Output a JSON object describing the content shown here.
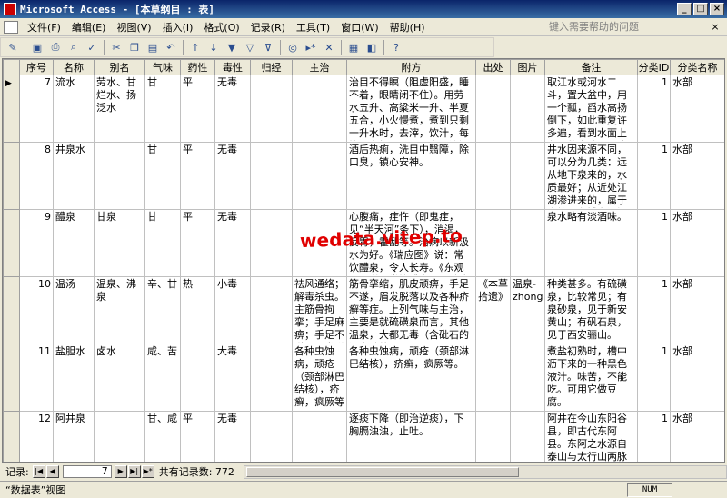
{
  "window": {
    "title": "Microsoft Access - [本草纲目 : 表]",
    "min": "_",
    "max": "□",
    "close": "×"
  },
  "menu": {
    "items": [
      "文件(F)",
      "编辑(E)",
      "视图(V)",
      "插入(I)",
      "格式(O)",
      "记录(R)",
      "工具(T)",
      "窗口(W)",
      "帮助(H)"
    ],
    "help_placeholder": "键入需要帮助的问题",
    "close": "×"
  },
  "toolbar": {
    "icons": [
      "view-icon",
      "save-icon",
      "print-icon",
      "preview-icon",
      "spell-icon",
      "cut-icon",
      "copy-icon",
      "paste-icon",
      "undo-icon",
      "sort-asc-icon",
      "sort-desc-icon",
      "filter-icon",
      "filter-form-icon",
      "apply-filter-icon",
      "find-icon",
      "new-record-icon",
      "delete-record-icon",
      "database-window-icon",
      "new-object-icon",
      "help-icon"
    ]
  },
  "columns": [
    "序号",
    "名称",
    "别名",
    "气味",
    "药性",
    "毒性",
    "归经",
    "主治",
    "附方",
    "出处",
    "图片",
    "备注",
    "分类ID",
    "分类名称"
  ],
  "rows": [
    {
      "id": "7",
      "name": "流水",
      "alias": "劳水、甘烂水、扬泛水",
      "taste": "甘",
      "nature": "平",
      "toxicity": "无毒",
      "meridian": "",
      "indication": "",
      "formula": "治目不得瞑（阻虚阳盛，睡不着，眼睛闭不住）。用劳水五升、高粱米一升、半夏五合，小火慢煮，煮到只剩一升水时，去滓，饮汁，每饮一小杯。一日三次。治汗后奔豚",
      "source": "",
      "image": "",
      "note": "取江水或河水二斗，置大盆中，用一个瓢，舀水高扬倒下，如此重复许多遍，看到水面上有无数水珠滚来滚去便是",
      "cat_id": "1",
      "cat_name": "水部"
    },
    {
      "id": "8",
      "name": "井泉水",
      "alias": "",
      "taste": "甘",
      "nature": "平",
      "toxicity": "无毒",
      "meridian": "",
      "indication": "",
      "formula": "酒后热痢，洗目中翳障，除口臭，镇心安神。",
      "source": "",
      "image": "",
      "note": "井水因来源不同，可以分为几类：远从地下泉来的，水质最好；从近处江湖渗进来的，属于次等；有城市沟渠污水",
      "cat_id": "1",
      "cat_name": "水部"
    },
    {
      "id": "9",
      "name": "醴泉",
      "alias": "甘泉",
      "taste": "甘",
      "nature": "平",
      "toxicity": "无毒",
      "meridian": "",
      "indication": "",
      "formula": "心腹痛，疰忤（即鬼疰，见“半天河”条下），消渴，反胃，霍乱等。治病以新汲水为好。《瑞应图》说：常饮醴泉，令人长寿。《东观记》说：常饮醴泉，可除痼疾（久",
      "source": "",
      "image": "",
      "note": "泉水略有淡酒味。",
      "cat_id": "1",
      "cat_name": "水部"
    },
    {
      "id": "10",
      "name": "温汤",
      "alias": "温泉、沸泉",
      "taste": "辛、甘",
      "nature": "热",
      "toxicity": "小毒",
      "meridian": "",
      "indication": "祛风通络；解毒杀虫。主筋骨拘挛；手足麻痹；手足不遂；眉发脱落；",
      "formula": "筋骨挛缩，肌皮顽痹，手足不遂，眉发脱落以及各种疥癣等症。上列气味与主治，主要是就硫磺泉而言，其他温泉，大都无毒（含砒石的温泉除外），即",
      "source": "《本草拾遗》",
      "image": "温泉-zhongyao.jpg",
      "note": "种类甚多。有硫磺泉，比较常见；有泉砂泉，见于新安黄山；有矾石泉，见于西安骊山。",
      "cat_id": "1",
      "cat_name": "水部"
    },
    {
      "id": "11",
      "name": "盐胆水",
      "alias": "卤水",
      "taste": "咸、苦",
      "nature": "",
      "toxicity": "大毒",
      "meridian": "",
      "indication": "各种虫蚀病，顽疮（颈部淋巴结核），疥癣，疯厥等",
      "formula": "各种虫蚀病，顽疮（颈部淋巴结核），疥癣，疯厥等。",
      "source": "",
      "image": "",
      "note": "煮盐初熟时，槽中沥下来的一种黑色液汁。味苦，不能吃。可用它做豆腐。",
      "cat_id": "1",
      "cat_name": "水部"
    },
    {
      "id": "12",
      "name": "阿井泉",
      "alias": "",
      "taste": "甘、咸",
      "nature": "平",
      "toxicity": "无毒",
      "meridian": "",
      "indication": "",
      "formula": "逐痰下降（即治逆痰），下胸膈浊浊，止吐。",
      "source": "",
      "image": "",
      "note": "阿井在今山东阳谷县，即古代东阿县。东阿之水源自泰山与太行山两脉地下潜流，积于东阿。经层层地下岩石，或层层",
      "cat_id": "1",
      "cat_name": "水部"
    }
  ],
  "nav": {
    "label": "记录:",
    "current": "7",
    "total_label": "共有记录数: 772"
  },
  "status": {
    "view": "“数据表”视图",
    "num": "NUM"
  },
  "watermark": "wedata.vitep.to"
}
